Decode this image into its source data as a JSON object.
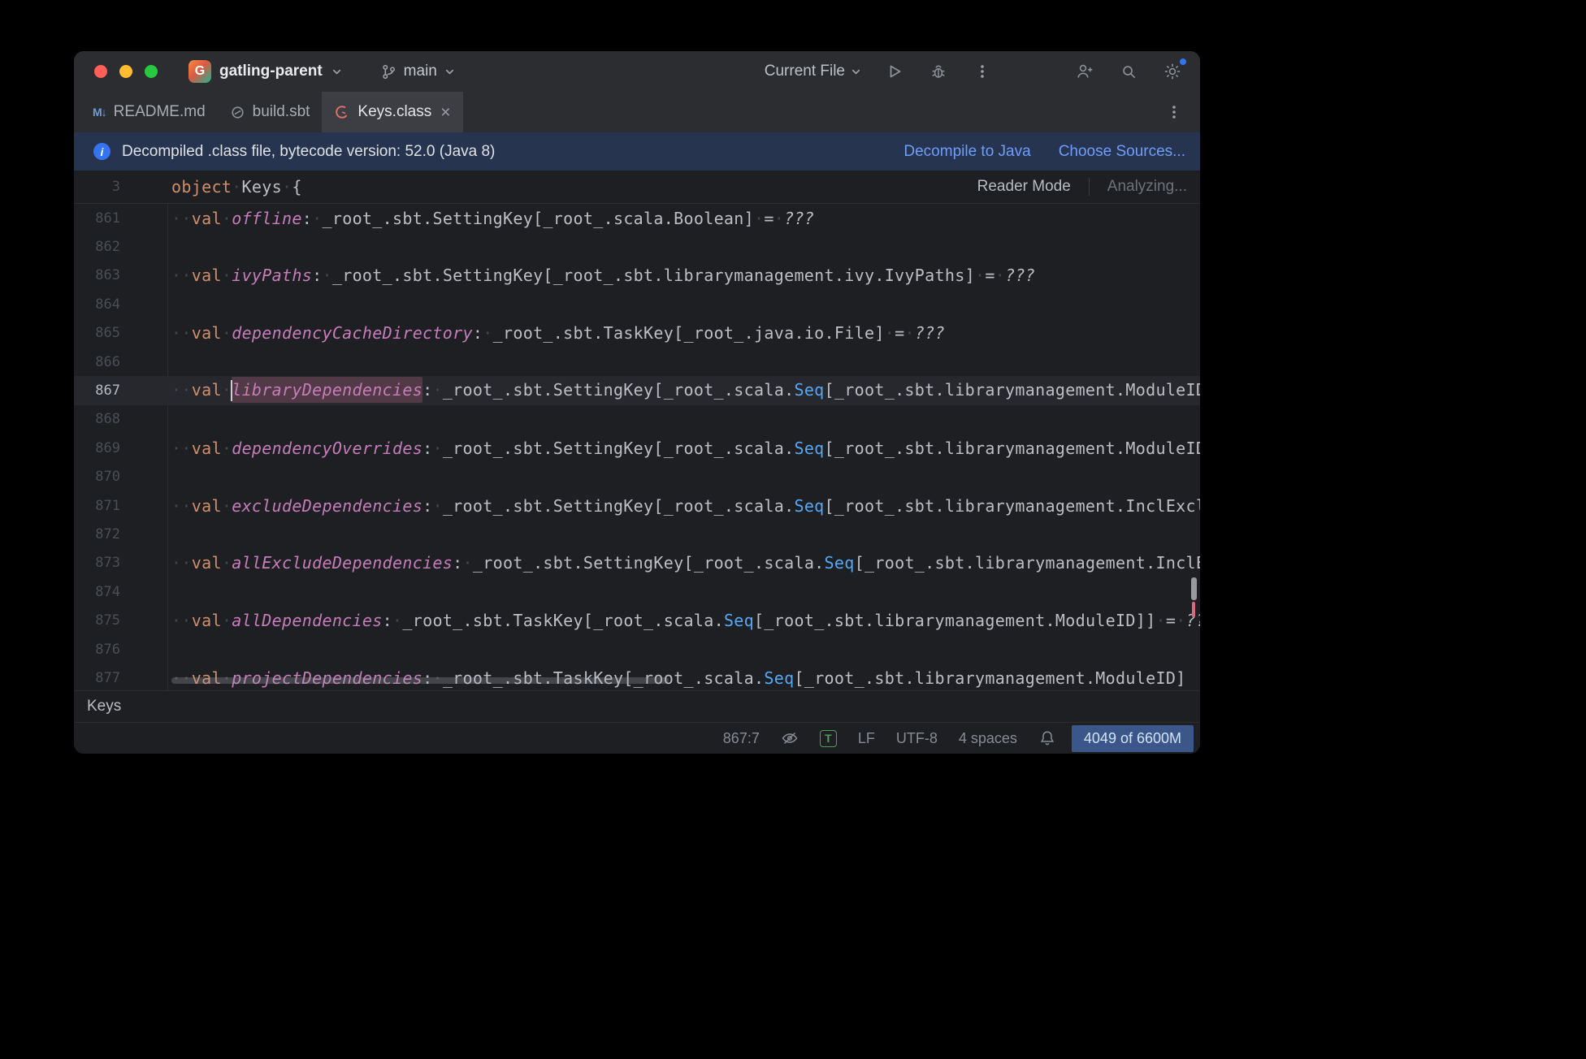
{
  "window": {
    "project_name": "gatling-parent",
    "branch_name": "main",
    "run_config": "Current File"
  },
  "tabs": [
    {
      "label": "README.md",
      "icon": "markdown"
    },
    {
      "label": "build.sbt",
      "icon": "sbt"
    },
    {
      "label": "Keys.class",
      "icon": "decompiled-class",
      "active": true,
      "close": "×"
    }
  ],
  "banner": {
    "message": "Decompiled .class file, bytecode version: 52.0 (Java 8)",
    "actions": [
      "Decompile to Java",
      "Choose Sources..."
    ]
  },
  "sticky": {
    "line_number": "3",
    "tokens": [
      {
        "t": "object",
        "c": "kw"
      },
      {
        "t": "·",
        "c": "ws"
      },
      {
        "t": "Keys",
        "c": "pl"
      },
      {
        "t": "·",
        "c": "ws"
      },
      {
        "t": "{",
        "c": "pl"
      }
    ],
    "reader_mode": "Reader Mode",
    "analyzing": "Analyzing..."
  },
  "editor": {
    "lines": [
      {
        "num": "861",
        "tokens": [
          {
            "t": "··",
            "c": "ws"
          },
          {
            "t": "val",
            "c": "kw"
          },
          {
            "t": "·",
            "c": "ws"
          },
          {
            "t": "offline",
            "c": "fn"
          },
          {
            "t": ":",
            "c": "pl"
          },
          {
            "t": "·",
            "c": "ws"
          },
          {
            "t": "_root_.sbt.SettingKey[_root_.scala.Boolean]",
            "c": "pl"
          },
          {
            "t": "·",
            "c": "ws"
          },
          {
            "t": "=",
            "c": "pl"
          },
          {
            "t": "·",
            "c": "ws"
          },
          {
            "t": "???",
            "c": "im"
          }
        ]
      },
      {
        "num": "862",
        "tokens": []
      },
      {
        "num": "863",
        "tokens": [
          {
            "t": "··",
            "c": "ws"
          },
          {
            "t": "val",
            "c": "kw"
          },
          {
            "t": "·",
            "c": "ws"
          },
          {
            "t": "ivyPaths",
            "c": "fn"
          },
          {
            "t": ":",
            "c": "pl"
          },
          {
            "t": "·",
            "c": "ws"
          },
          {
            "t": "_root_.sbt.SettingKey[_root_.sbt.librarymanagement.ivy.IvyPaths]",
            "c": "pl"
          },
          {
            "t": "·",
            "c": "ws"
          },
          {
            "t": "=",
            "c": "pl"
          },
          {
            "t": "·",
            "c": "ws"
          },
          {
            "t": "???",
            "c": "im"
          }
        ]
      },
      {
        "num": "864",
        "tokens": []
      },
      {
        "num": "865",
        "tokens": [
          {
            "t": "··",
            "c": "ws"
          },
          {
            "t": "val",
            "c": "kw"
          },
          {
            "t": "·",
            "c": "ws"
          },
          {
            "t": "dependencyCacheDirectory",
            "c": "fn"
          },
          {
            "t": ":",
            "c": "pl"
          },
          {
            "t": "·",
            "c": "ws"
          },
          {
            "t": "_root_.sbt.TaskKey[_root_.java.io.File]",
            "c": "pl"
          },
          {
            "t": "·",
            "c": "ws"
          },
          {
            "t": "=",
            "c": "pl"
          },
          {
            "t": "·",
            "c": "ws"
          },
          {
            "t": "???",
            "c": "im"
          }
        ]
      },
      {
        "num": "866",
        "tokens": []
      },
      {
        "num": "867",
        "current": true,
        "tokens": [
          {
            "t": "··",
            "c": "ws"
          },
          {
            "t": "val",
            "c": "kw"
          },
          {
            "t": "·",
            "c": "ws"
          },
          {
            "t": "",
            "c": "caret"
          },
          {
            "t": "libraryDependencies",
            "c": "hl"
          },
          {
            "t": ":",
            "c": "pl"
          },
          {
            "t": "·",
            "c": "ws"
          },
          {
            "t": "_root_.sbt.SettingKey[_root_.scala.",
            "c": "pl"
          },
          {
            "t": "Seq",
            "c": "tp"
          },
          {
            "t": "[_root_.sbt.librarymanagement.ModuleID",
            "c": "pl"
          }
        ]
      },
      {
        "num": "868",
        "tokens": []
      },
      {
        "num": "869",
        "tokens": [
          {
            "t": "··",
            "c": "ws"
          },
          {
            "t": "val",
            "c": "kw"
          },
          {
            "t": "·",
            "c": "ws"
          },
          {
            "t": "dependencyOverrides",
            "c": "fn"
          },
          {
            "t": ":",
            "c": "pl"
          },
          {
            "t": "·",
            "c": "ws"
          },
          {
            "t": "_root_.sbt.SettingKey[_root_.scala.",
            "c": "pl"
          },
          {
            "t": "Seq",
            "c": "tp"
          },
          {
            "t": "[_root_.sbt.librarymanagement.ModuleID",
            "c": "pl"
          }
        ]
      },
      {
        "num": "870",
        "tokens": []
      },
      {
        "num": "871",
        "tokens": [
          {
            "t": "··",
            "c": "ws"
          },
          {
            "t": "val",
            "c": "kw"
          },
          {
            "t": "·",
            "c": "ws"
          },
          {
            "t": "excludeDependencies",
            "c": "fn"
          },
          {
            "t": ":",
            "c": "pl"
          },
          {
            "t": "·",
            "c": "ws"
          },
          {
            "t": "_root_.sbt.SettingKey[_root_.scala.",
            "c": "pl"
          },
          {
            "t": "Seq",
            "c": "tp"
          },
          {
            "t": "[_root_.sbt.librarymanagement.InclExcl",
            "c": "pl"
          }
        ]
      },
      {
        "num": "872",
        "tokens": []
      },
      {
        "num": "873",
        "tokens": [
          {
            "t": "··",
            "c": "ws"
          },
          {
            "t": "val",
            "c": "kw"
          },
          {
            "t": "·",
            "c": "ws"
          },
          {
            "t": "allExcludeDependencies",
            "c": "fn"
          },
          {
            "t": ":",
            "c": "pl"
          },
          {
            "t": "·",
            "c": "ws"
          },
          {
            "t": "_root_.sbt.SettingKey[_root_.scala.",
            "c": "pl"
          },
          {
            "t": "Seq",
            "c": "tp"
          },
          {
            "t": "[_root_.sbt.librarymanagement.InclE",
            "c": "pl"
          }
        ]
      },
      {
        "num": "874",
        "tokens": []
      },
      {
        "num": "875",
        "tokens": [
          {
            "t": "··",
            "c": "ws"
          },
          {
            "t": "val",
            "c": "kw"
          },
          {
            "t": "·",
            "c": "ws"
          },
          {
            "t": "allDependencies",
            "c": "fn"
          },
          {
            "t": ":",
            "c": "pl"
          },
          {
            "t": "·",
            "c": "ws"
          },
          {
            "t": "_root_.sbt.TaskKey[_root_.scala.",
            "c": "pl"
          },
          {
            "t": "Seq",
            "c": "tp"
          },
          {
            "t": "[_root_.sbt.librarymanagement.ModuleID]]",
            "c": "pl"
          },
          {
            "t": "·",
            "c": "ws"
          },
          {
            "t": "=",
            "c": "pl"
          },
          {
            "t": "·",
            "c": "ws"
          },
          {
            "t": "???",
            "c": "im"
          }
        ]
      },
      {
        "num": "876",
        "tokens": []
      },
      {
        "num": "877",
        "tokens": [
          {
            "t": "··",
            "c": "ws"
          },
          {
            "t": "val",
            "c": "kw"
          },
          {
            "t": "·",
            "c": "ws"
          },
          {
            "t": "projectDependencies",
            "c": "fn"
          },
          {
            "t": ":",
            "c": "pl"
          },
          {
            "t": "·",
            "c": "ws"
          },
          {
            "t": "_root_.sbt.TaskKey[_root_.scala.",
            "c": "pl"
          },
          {
            "t": "Seq",
            "c": "tp"
          },
          {
            "t": "[_root_.sbt.librarymanagement.ModuleID]",
            "c": "pl"
          }
        ]
      }
    ]
  },
  "breadcrumb": "Keys",
  "status_bar": {
    "caret_position": "867:7",
    "todo_letter": "T",
    "line_separator": "LF",
    "encoding": "UTF-8",
    "indent": "4 spaces",
    "memory": "4049 of 6600M"
  },
  "icons": {
    "markdown-icon": "M↓",
    "project-icon-letter": "G",
    "info-icon": "i",
    "close-icon": "×"
  },
  "colors": {
    "accent_blue": "#3574f0",
    "link_blue": "#6f9dfa",
    "banner_bg": "#263450",
    "chrome_bg": "#2b2d30",
    "editor_bg": "#1e1f22",
    "keyword_orange": "#cf8e6d",
    "member_pink": "#c77dbb",
    "type_blue": "#56a8f5",
    "todo_green": "#4f9e58",
    "memory_badge_bg": "#3b5688"
  }
}
